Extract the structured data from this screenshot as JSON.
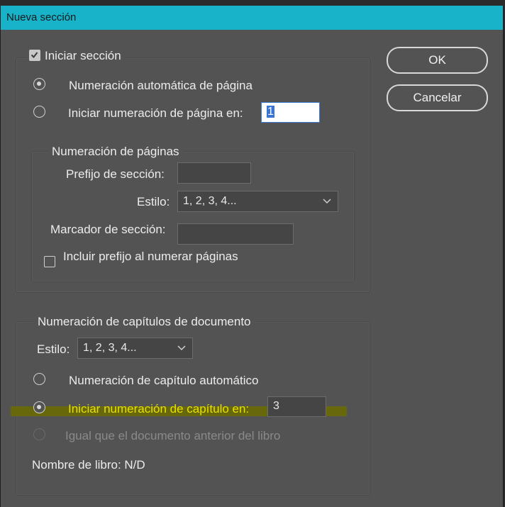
{
  "window": {
    "title": "Nueva sección"
  },
  "section": {
    "start_label": "Iniciar sección",
    "auto_page_label": "Numeración automática de página",
    "start_page_label": "Iniciar numeración de página en:",
    "start_page_value": "1"
  },
  "page_numbering": {
    "legend": "Numeración de páginas",
    "prefix_label": "Prefijo de sección:",
    "prefix_value": "",
    "style_label": "Estilo:",
    "style_value": "1, 2, 3, 4...",
    "marker_label": "Marcador de sección:",
    "marker_value": "",
    "include_prefix_label": "Incluir prefijo al numerar páginas"
  },
  "chapter_numbering": {
    "legend": "Numeración de capítulos de documento",
    "style_label": "Estilo:",
    "style_value": "1, 2, 3, 4...",
    "auto_label": "Numeración de capítulo automático",
    "start_label": "Iniciar numeración de capítulo en:",
    "start_value": "3",
    "same_as_prev_label": "Igual que el documento anterior del libro",
    "book_name_label": "Nombre de libro: N/D"
  },
  "buttons": {
    "ok": "OK",
    "cancel": "Cancelar"
  },
  "colors": {
    "titlebar": "#18b3c8",
    "dialog_bg": "#535353",
    "highlight": "#6b6b00",
    "highlight_text": "#e8e000"
  }
}
